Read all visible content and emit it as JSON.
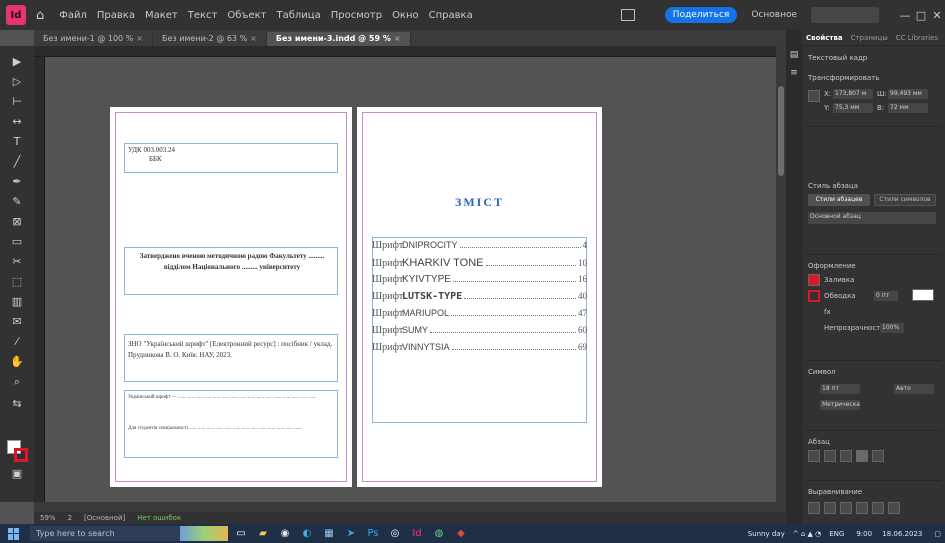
{
  "app": {
    "logo_text": "Id",
    "menu": [
      "Файл",
      "Правка",
      "Макет",
      "Текст",
      "Объект",
      "Таблица",
      "Просмотр",
      "Окно",
      "Справка"
    ],
    "publish_label": "Поделиться",
    "workspace_label": "Основное",
    "search_placeholder": "",
    "window_controls": [
      "—",
      "□",
      "✕"
    ]
  },
  "tabs": [
    {
      "label": "Без имени-1 @ 100 %",
      "active": false
    },
    {
      "label": "Без имени-2 @ 63 %",
      "active": false
    },
    {
      "label": "Без имени-3.indd @ 59 %",
      "active": true
    }
  ],
  "document": {
    "left_page": {
      "udk": "УДК 003.003.24",
      "bbk": "ББК",
      "approval": "Затверджено вченою методичною радою Факультету ......... відділом Національного ......... університету",
      "citation": "ЗНО \"Український шрифт\" [Електронний ресурс] : посібник / уклад. Прудникова В. О. Київ: НАУ, 2023.",
      "abstract_1": "Український шрифт — ...... ...... ...... ...... ...... ...... ...... ...... ...... ...... ...... ...... ...... ...... ...... ......",
      "abstract_2": "Для студентів спеціальності ...... ...... ...... ...... ...... ...... ...... ...... ...... ...... ...... ...... ......"
    },
    "right_page": {
      "toc_title": "ЗМІСТ",
      "toc": [
        {
          "prefix": "Шрифт",
          "font": "DNIPROCITY",
          "page": "4"
        },
        {
          "prefix": "Шрифт",
          "font": "KHARKIV TONE",
          "page": "10"
        },
        {
          "prefix": "Шрифт",
          "font": "KYIVTYPE",
          "page": "16"
        },
        {
          "prefix": "Шрифт",
          "font": "LUTSK-TYPE",
          "page": "40"
        },
        {
          "prefix": "Шрифт",
          "font": "MARIUPOL",
          "page": "47"
        },
        {
          "prefix": "Шрифт",
          "font": "SUMY",
          "page": "60"
        },
        {
          "prefix": "Шрифт",
          "font": "VINNYTSIA",
          "page": "69"
        }
      ]
    }
  },
  "statusbar": {
    "zoom": "59%",
    "page": "2",
    "style": "[Основной]",
    "errors": "Нет ошибок"
  },
  "properties": {
    "tabs": [
      "Свойства",
      "Страницы",
      "CC Libraries"
    ],
    "section_text_frame": "Текстовый кадр",
    "section_transform": "Трансформировать",
    "x_label": "X:",
    "x_value": "173,807 м",
    "y_label": "Y:",
    "y_value": "75,3 мм",
    "w_label": "Ш:",
    "w_value": "99,493 мм",
    "h_label": "В:",
    "h_value": "72 мм",
    "section_style": "Стиль абзаца",
    "style_btn_1": "Стили абзацев",
    "style_btn_2": "Стили символов",
    "style_value": "Основной абзац",
    "section_appearance": "Оформление",
    "fill_label": "Заливка",
    "stroke_label": "Обводка",
    "stroke_value": "0 пт",
    "fx_label": "fx",
    "opacity_label": "Непрозрачность",
    "opacity_value": "100%",
    "section_font": "Символ",
    "size_label": "18 пт",
    "leading_label": "Авто",
    "tracking_label": "Метрическая",
    "section_paragraph": "Абзац",
    "section_align": "Выравнивание",
    "fill_color": "#e0162b",
    "stroke_color": "#ffffff"
  },
  "taskbar": {
    "search_placeholder": "Type here to search",
    "weather": "Sunny day",
    "lang": "ENG",
    "time": "9:00",
    "date": "18.06.2023"
  }
}
